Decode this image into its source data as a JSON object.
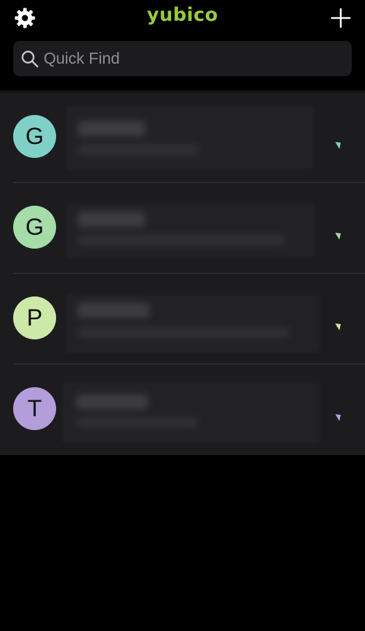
{
  "header": {
    "settings_icon": "gear-icon",
    "brand": "yubico",
    "brand_color": "#9aca3c",
    "add_icon": "plus-icon"
  },
  "search": {
    "placeholder": "Quick Find",
    "value": ""
  },
  "accounts": [
    {
      "initial": "G",
      "avatar_color": "#7fd1c8",
      "indicator_color": "#7fd1c8"
    },
    {
      "initial": "G",
      "avatar_color": "#a5dca8",
      "indicator_color": "#a5dca8"
    },
    {
      "initial": "P",
      "avatar_color": "#cde9a8",
      "indicator_color": "#cde9a8"
    },
    {
      "initial": "T",
      "avatar_color": "#b39ddb",
      "indicator_color": "#b39ddb"
    }
  ]
}
